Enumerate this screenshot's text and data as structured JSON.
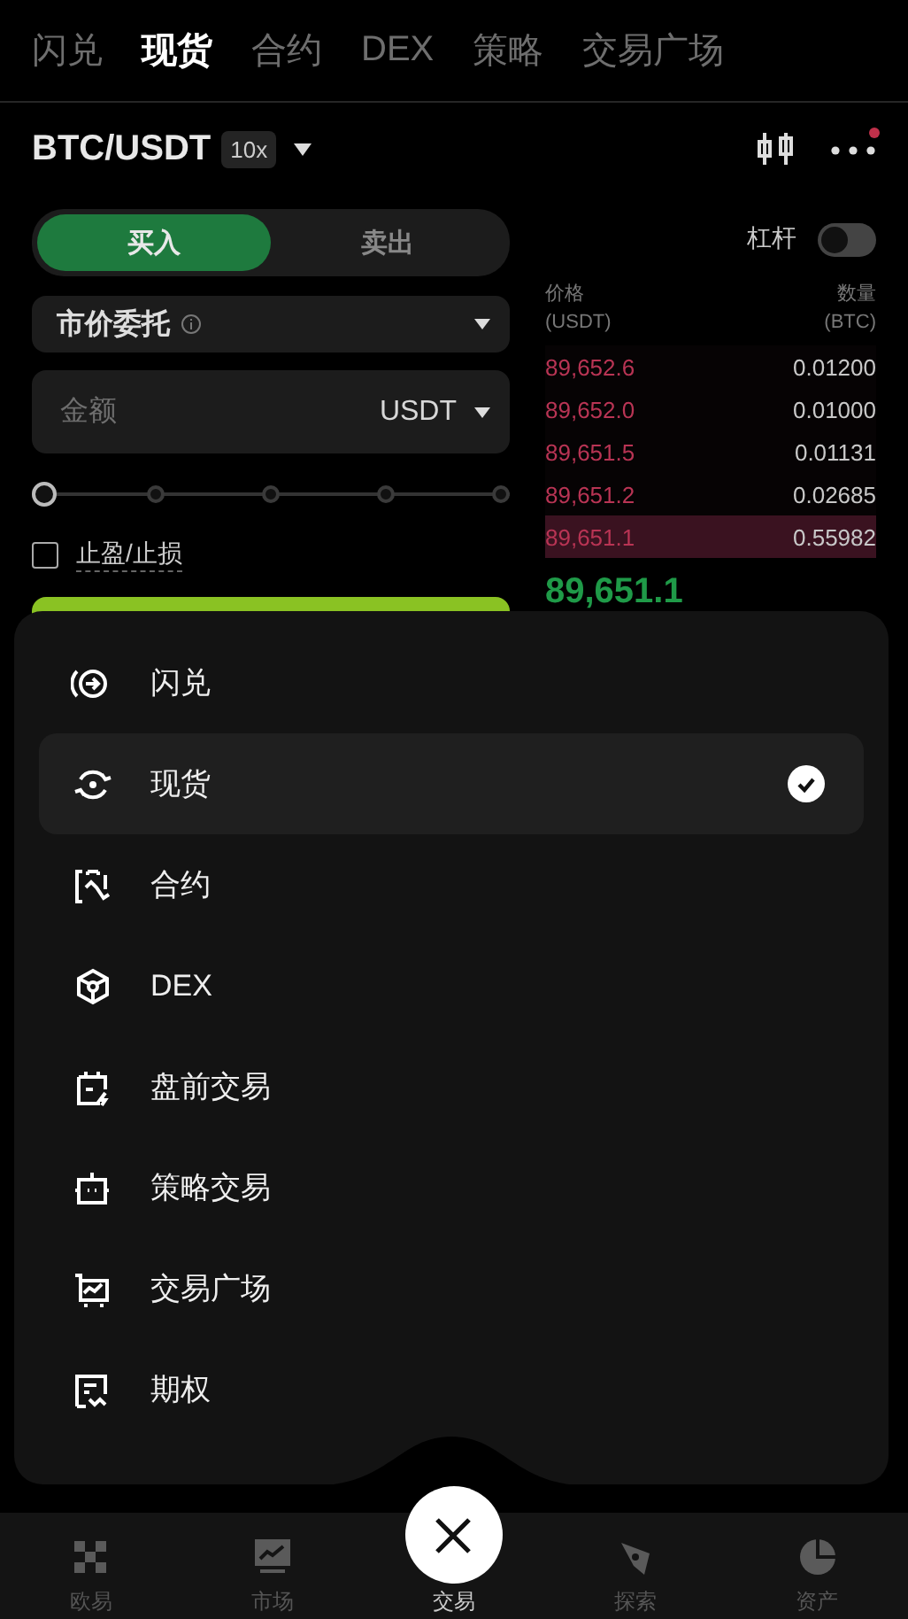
{
  "top_tabs": [
    {
      "label": "闪兑",
      "selected": false
    },
    {
      "label": "现货",
      "selected": true
    },
    {
      "label": "合约",
      "selected": false
    },
    {
      "label": "DEX",
      "selected": false
    },
    {
      "label": "策略",
      "selected": false
    },
    {
      "label": "交易广场",
      "selected": false
    }
  ],
  "header": {
    "pair": "BTC/USDT",
    "leverage": "10x",
    "has_notification": true
  },
  "trade_form": {
    "sides": [
      {
        "label": "买入",
        "selected": true
      },
      {
        "label": "卖出",
        "selected": false
      }
    ],
    "order_type": "市价委托",
    "amount": {
      "placeholder": "金额",
      "unit": "USDT"
    },
    "slider": {
      "level": 0
    },
    "tp_sl": {
      "label": "止盈/止损",
      "checked": false
    }
  },
  "margin_toggle": {
    "label": "杠杆",
    "on": false
  },
  "order_book": {
    "price_header": [
      "价格",
      "(USDT)"
    ],
    "qty_header": [
      "数量",
      "(BTC)"
    ],
    "asks": [
      {
        "price": "89,652.6",
        "qty": "0.01200",
        "highlighted": false
      },
      {
        "price": "89,652.0",
        "qty": "0.01000",
        "highlighted": false
      },
      {
        "price": "89,651.5",
        "qty": "0.01131",
        "highlighted": false
      },
      {
        "price": "89,651.2",
        "qty": "0.02685",
        "highlighted": false
      },
      {
        "price": "89,651.1",
        "qty": "0.55982",
        "highlighted": true
      }
    ],
    "last_price": "89,651.1"
  },
  "menu": {
    "items": [
      {
        "label": "闪兑",
        "selected": false
      },
      {
        "label": "现货",
        "selected": true
      },
      {
        "label": "合约",
        "selected": false
      },
      {
        "label": "DEX",
        "selected": false
      },
      {
        "label": "盘前交易",
        "selected": false
      },
      {
        "label": "策略交易",
        "selected": false
      },
      {
        "label": "交易广场",
        "selected": false
      },
      {
        "label": "期权",
        "selected": false
      }
    ]
  },
  "bottom_nav": [
    {
      "label": "欧易",
      "selected": false
    },
    {
      "label": "市场",
      "selected": false
    },
    {
      "label": "交易",
      "selected": true
    },
    {
      "label": "探索",
      "selected": false
    },
    {
      "label": "资产",
      "selected": false
    }
  ]
}
